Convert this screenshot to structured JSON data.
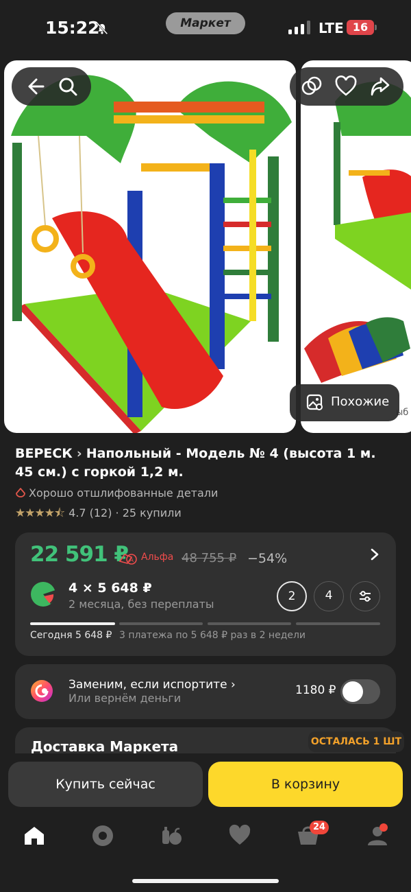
{
  "status_bar": {
    "time": "15:22",
    "app_pill": "Маркет",
    "network": "LTE",
    "battery": "16"
  },
  "gallery": {
    "similar_label": "Похожие",
    "next_photo_text": "ыб"
  },
  "product": {
    "brand": "ВЕРЕСК",
    "name": "Напольный - Модель № 4 (высота 1 м. 45 см.) с горкой 1,2 м.",
    "feature": "Хорошо отшлифованные детали",
    "rating_value": "4.7",
    "rating_count": "(12)",
    "purchases": "· 25 купили",
    "rating_stars": 4.5
  },
  "price": {
    "current": "22 591 ₽",
    "card_label": "Альфа",
    "old": "48 755 ₽",
    "discount": "−54%",
    "split_amount": "4 × 5 648 ₽",
    "split_sub": "2 месяца, без переплаты",
    "options": [
      "2",
      "4"
    ],
    "today": "Сегодня 5 648 ₽",
    "later": "3 платежа по 5 648 ₽ раз в 2 недели"
  },
  "protection": {
    "title": "Заменим, если испортите",
    "subtitle": "Или вернём деньги",
    "price": "1180 ₽",
    "enabled": false
  },
  "delivery": {
    "title": "Доставка Маркета",
    "stock_badge": "ОСТАЛАСЬ 1 ШТ"
  },
  "actions": {
    "buy_now": "Купить сейчас",
    "to_cart": "В корзину"
  },
  "tabbar": {
    "cart_badge": "24",
    "icons": [
      "home-icon",
      "alice-icon",
      "catalog-icon",
      "favorites-icon",
      "cart-icon",
      "profile-icon"
    ]
  },
  "colors": {
    "price_green": "#41c27a",
    "cart_yellow": "#fdd82b",
    "badge_red": "#f0463a",
    "stock_orange": "#f2a12a"
  }
}
